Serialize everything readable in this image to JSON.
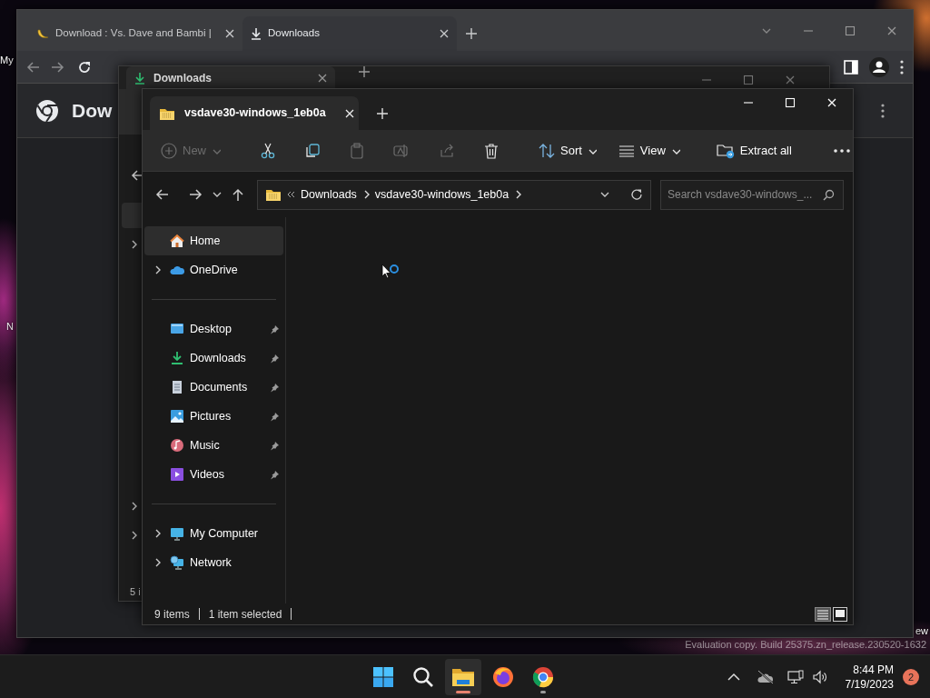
{
  "desktop": {
    "icon_labels": [
      "My",
      "N",
      "ew"
    ],
    "watermark": "Evaluation copy. Build 25375.zn_release.230520-1632"
  },
  "chrome": {
    "tabs": [
      {
        "title": "Download : Vs. Dave and Bambi |",
        "selected": false
      },
      {
        "title": "Downloads",
        "selected": true
      }
    ],
    "page_title": "Dow"
  },
  "back_explorer": {
    "tab": "Downloads",
    "status_bar": "5 i"
  },
  "explorer": {
    "tab": "vsdave30-windows_1eb0a",
    "toolbar": [
      {
        "kind": "menu",
        "label": "New",
        "disabled": true
      },
      {
        "kind": "icon",
        "disabled": false
      },
      {
        "kind": "icon",
        "disabled": false
      },
      {
        "kind": "icon",
        "disabled": true
      },
      {
        "kind": "icon",
        "disabled": true
      },
      {
        "kind": "icon",
        "disabled": true
      },
      {
        "kind": "icon",
        "disabled": false
      },
      {
        "kind": "menu",
        "label": "Sort",
        "disabled": false
      },
      {
        "kind": "menu",
        "label": "View",
        "disabled": false
      },
      {
        "kind": "button",
        "label": "Extract all",
        "disabled": false
      },
      {
        "kind": "icon",
        "disabled": false
      }
    ],
    "breadcrumb": [
      "Downloads",
      "vsdave30-windows_1eb0a"
    ],
    "search": {
      "placeholder": "Search vsdave30-windows_..."
    },
    "nav_groups": [
      [
        {
          "label": "Home",
          "selected": true,
          "expandable": false,
          "pinned": false
        },
        {
          "label": "OneDrive",
          "selected": false,
          "expandable": true,
          "pinned": false
        }
      ],
      [
        {
          "label": "Desktop",
          "selected": false,
          "expandable": false,
          "pinned": true
        },
        {
          "label": "Downloads",
          "selected": false,
          "expandable": false,
          "pinned": true
        },
        {
          "label": "Documents",
          "selected": false,
          "expandable": false,
          "pinned": true
        },
        {
          "label": "Pictures",
          "selected": false,
          "expandable": false,
          "pinned": true
        },
        {
          "label": "Music",
          "selected": false,
          "expandable": false,
          "pinned": true
        },
        {
          "label": "Videos",
          "selected": false,
          "expandable": false,
          "pinned": true
        }
      ],
      [
        {
          "label": "My Computer",
          "selected": false,
          "expandable": true,
          "pinned": false
        },
        {
          "label": "Network",
          "selected": false,
          "expandable": true,
          "pinned": false
        }
      ]
    ],
    "status_bar": {
      "item_count": "9 items",
      "selection": "1 item selected"
    }
  },
  "taskbar": {
    "apps": [
      {
        "running": false,
        "active": false
      },
      {
        "running": false,
        "active": false
      },
      {
        "running": true,
        "active": true
      },
      {
        "running": false,
        "active": false
      },
      {
        "running": true,
        "active": false
      }
    ],
    "time": "8:44 PM",
    "date": "7/19/2023",
    "notifications": "2"
  }
}
